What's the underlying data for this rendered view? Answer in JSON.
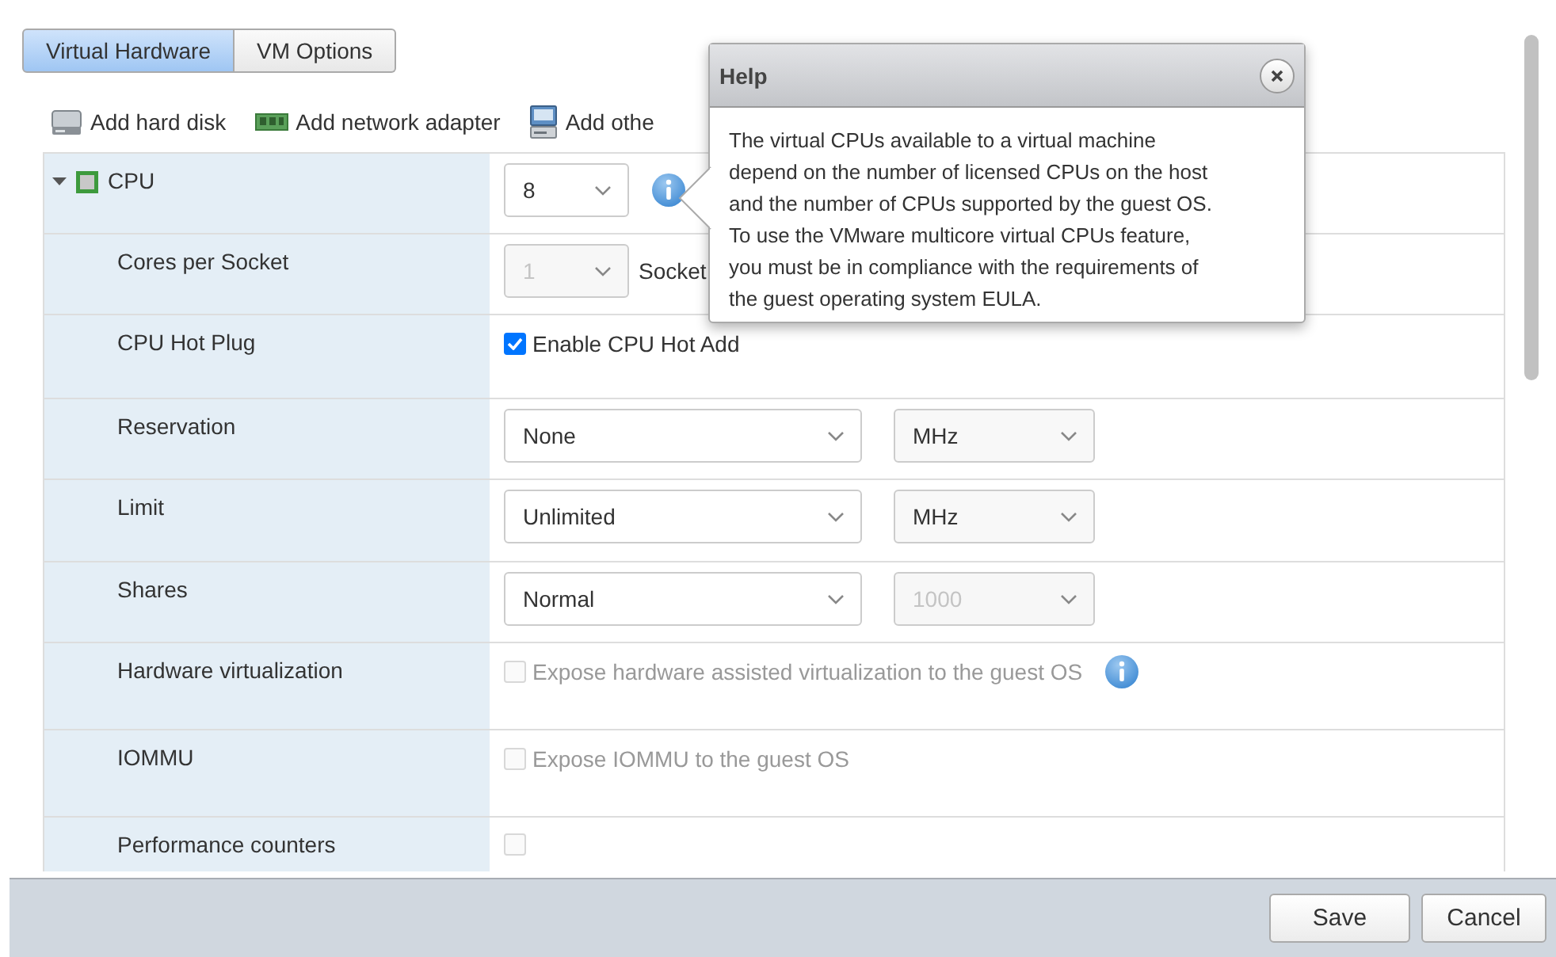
{
  "tabs": [
    {
      "label": "Virtual Hardware",
      "selected": true
    },
    {
      "label": "VM Options",
      "selected": false
    }
  ],
  "toolbar": [
    {
      "kind": "disk",
      "label": "Add hard disk"
    },
    {
      "kind": "network",
      "label": "Add network adapter"
    },
    {
      "kind": "device",
      "label": "Add othe"
    }
  ],
  "rows": [
    {
      "label": "CPU",
      "expanded": true,
      "controls": [
        {
          "kind": "count_select",
          "value": "8",
          "disabled": false
        },
        {
          "kind": "info"
        }
      ]
    },
    {
      "label": "Cores per Socket",
      "controls": [
        {
          "kind": "count_select",
          "value": "1",
          "disabled": true
        },
        {
          "kind": "text",
          "text": "Socket"
        }
      ]
    },
    {
      "label": "CPU Hot Plug",
      "controls": [
        {
          "kind": "checkbox",
          "label": "Enable CPU Hot Add",
          "checked": true,
          "disabled": false
        }
      ]
    },
    {
      "label": "Reservation",
      "controls": [
        {
          "kind": "select",
          "value": "None",
          "disabled": false
        },
        {
          "kind": "unit_select",
          "value": "MHz",
          "disabled": false
        }
      ]
    },
    {
      "label": "Limit",
      "controls": [
        {
          "kind": "select",
          "value": "Unlimited",
          "disabled": false
        },
        {
          "kind": "unit_select",
          "value": "MHz",
          "disabled": false
        }
      ]
    },
    {
      "label": "Shares",
      "controls": [
        {
          "kind": "select",
          "value": "Normal",
          "disabled": false
        },
        {
          "kind": "unit_select",
          "value": "1000",
          "disabled": true
        }
      ]
    },
    {
      "label": "Hardware virtualization",
      "controls": [
        {
          "kind": "checkbox",
          "label": "Expose hardware assisted virtualization to the guest OS",
          "checked": false,
          "disabled": true
        },
        {
          "kind": "info"
        }
      ]
    },
    {
      "label": "IOMMU",
      "controls": [
        {
          "kind": "checkbox",
          "label": "Expose IOMMU to the guest OS",
          "checked": false,
          "disabled": true
        }
      ]
    },
    {
      "label": "Performance counters",
      "controls": [
        {
          "kind": "checkbox",
          "checked": false,
          "disabled": true
        }
      ]
    }
  ],
  "help": {
    "title": "Help",
    "text": "The virtual CPUs available to a virtual machine depend on the number of licensed CPUs on the host and the number of CPUs supported by the guest OS. To use the VMware multicore virtual CPUs feature, you must be in compliance with the requirements of the guest operating system EULA."
  },
  "buttons": [
    "Save",
    "Cancel"
  ]
}
